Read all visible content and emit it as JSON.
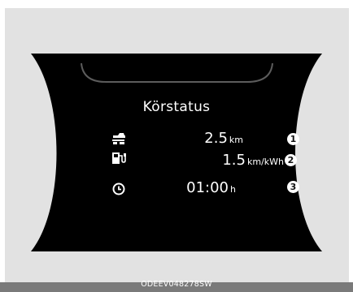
{
  "display": {
    "title": "Körstatus",
    "rows": [
      {
        "icon": "car-distance-icon",
        "value": "2.5",
        "unit": "km",
        "callout": "1"
      },
      {
        "icon": "charging-station-icon",
        "value": "1.5",
        "unit": "km/kWh",
        "callout": "2"
      },
      {
        "icon": "clock-icon",
        "value": "01:00",
        "unit": "h",
        "callout": "3"
      }
    ]
  },
  "caption": "ODEEV048278SW",
  "colors": {
    "panel_background": "#e2e2e2",
    "display_background": "#000000",
    "text": "#ffffff",
    "caption_bar": "#7a7a7a"
  }
}
